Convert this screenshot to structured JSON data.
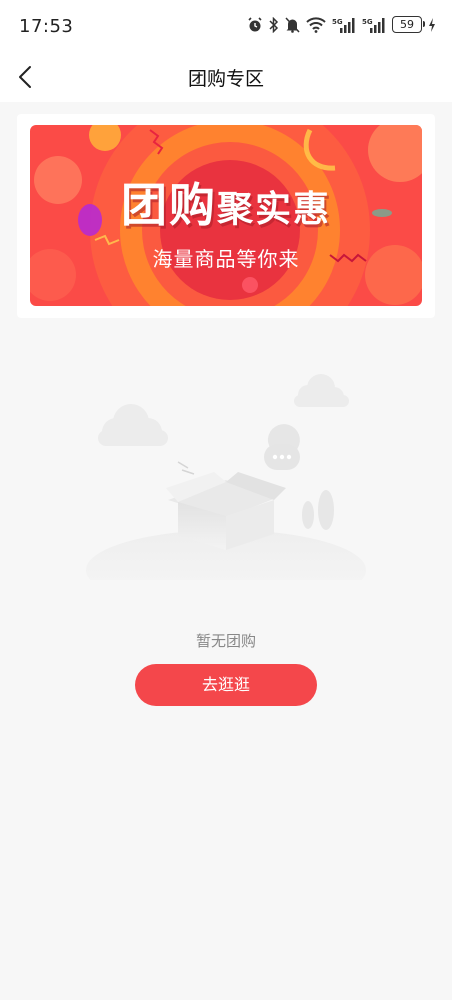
{
  "status_bar": {
    "time": "17:53",
    "battery": "59",
    "icons": [
      "alarm-icon",
      "bluetooth-icon",
      "mute-icon",
      "wifi-icon",
      "signal-5g-icon",
      "signal-5g-icon",
      "battery-icon",
      "charging-icon"
    ]
  },
  "nav": {
    "title": "团购专区",
    "back_icon": "back-arrow-icon"
  },
  "banner": {
    "headline_part1": "团购",
    "headline_part2": "聚实惠",
    "subtitle": "海量商品等你来"
  },
  "empty_state": {
    "illustration": "empty-box-illustration",
    "message": "暂无团购",
    "button_label": "去逛逛"
  },
  "colors": {
    "accent": "#f4474b",
    "banner_bg": "#fb4b47",
    "page_bg": "#f7f7f7"
  }
}
